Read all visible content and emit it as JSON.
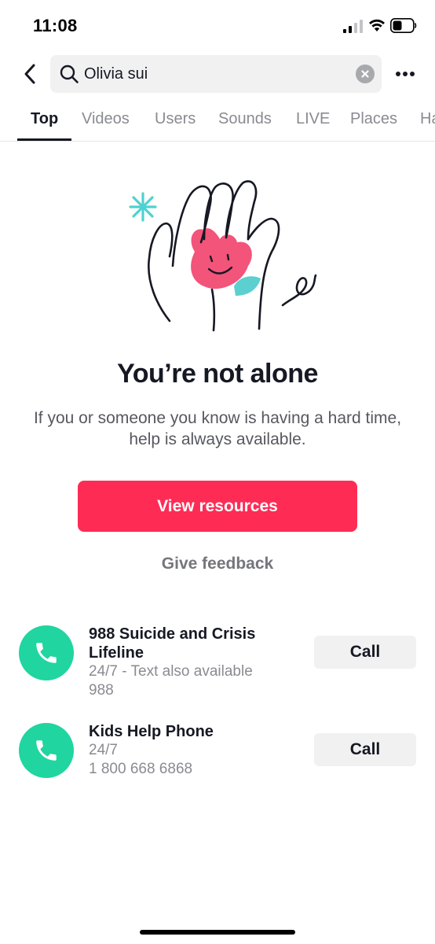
{
  "status_bar": {
    "time": "11:08",
    "icons": [
      "signal-icon",
      "wifi-icon",
      "battery-icon"
    ]
  },
  "header": {
    "back_icon": "chevron-left-icon",
    "search": {
      "value": "Olivia sui",
      "placeholder": "",
      "icon": "search-icon",
      "clear_icon": "clear-icon"
    },
    "more_icon": "more-horizontal-icon"
  },
  "tabs": [
    {
      "label": "Top",
      "active": true
    },
    {
      "label": "Videos",
      "active": false
    },
    {
      "label": "Users",
      "active": false
    },
    {
      "label": "Sounds",
      "active": false
    },
    {
      "label": "LIVE",
      "active": false
    },
    {
      "label": "Places",
      "active": false
    },
    {
      "label": "Ha",
      "active": false
    }
  ],
  "support": {
    "illustration": "hands-holding-heart-illustration",
    "headline": "You’re not alone",
    "description": "If you or someone you know is having a hard time, help is always available.",
    "primary_button": "View resources",
    "feedback_link": "Give feedback"
  },
  "helplines": [
    {
      "name": "988 Suicide and Crisis Lifeline",
      "detail_1": "24/7 - Text also available",
      "detail_2": "988",
      "call_label": "Call",
      "icon": "phone-icon"
    },
    {
      "name": "Kids Help Phone",
      "detail_1": "24/7",
      "detail_2": "1 800 668 6868",
      "call_label": "Call",
      "icon": "phone-icon"
    }
  ],
  "colors": {
    "accent": "#fe2c55",
    "phone_green": "#20d5a0",
    "text_primary": "#161823",
    "text_secondary": "#8a8b91",
    "search_bg": "#f1f1f2"
  }
}
